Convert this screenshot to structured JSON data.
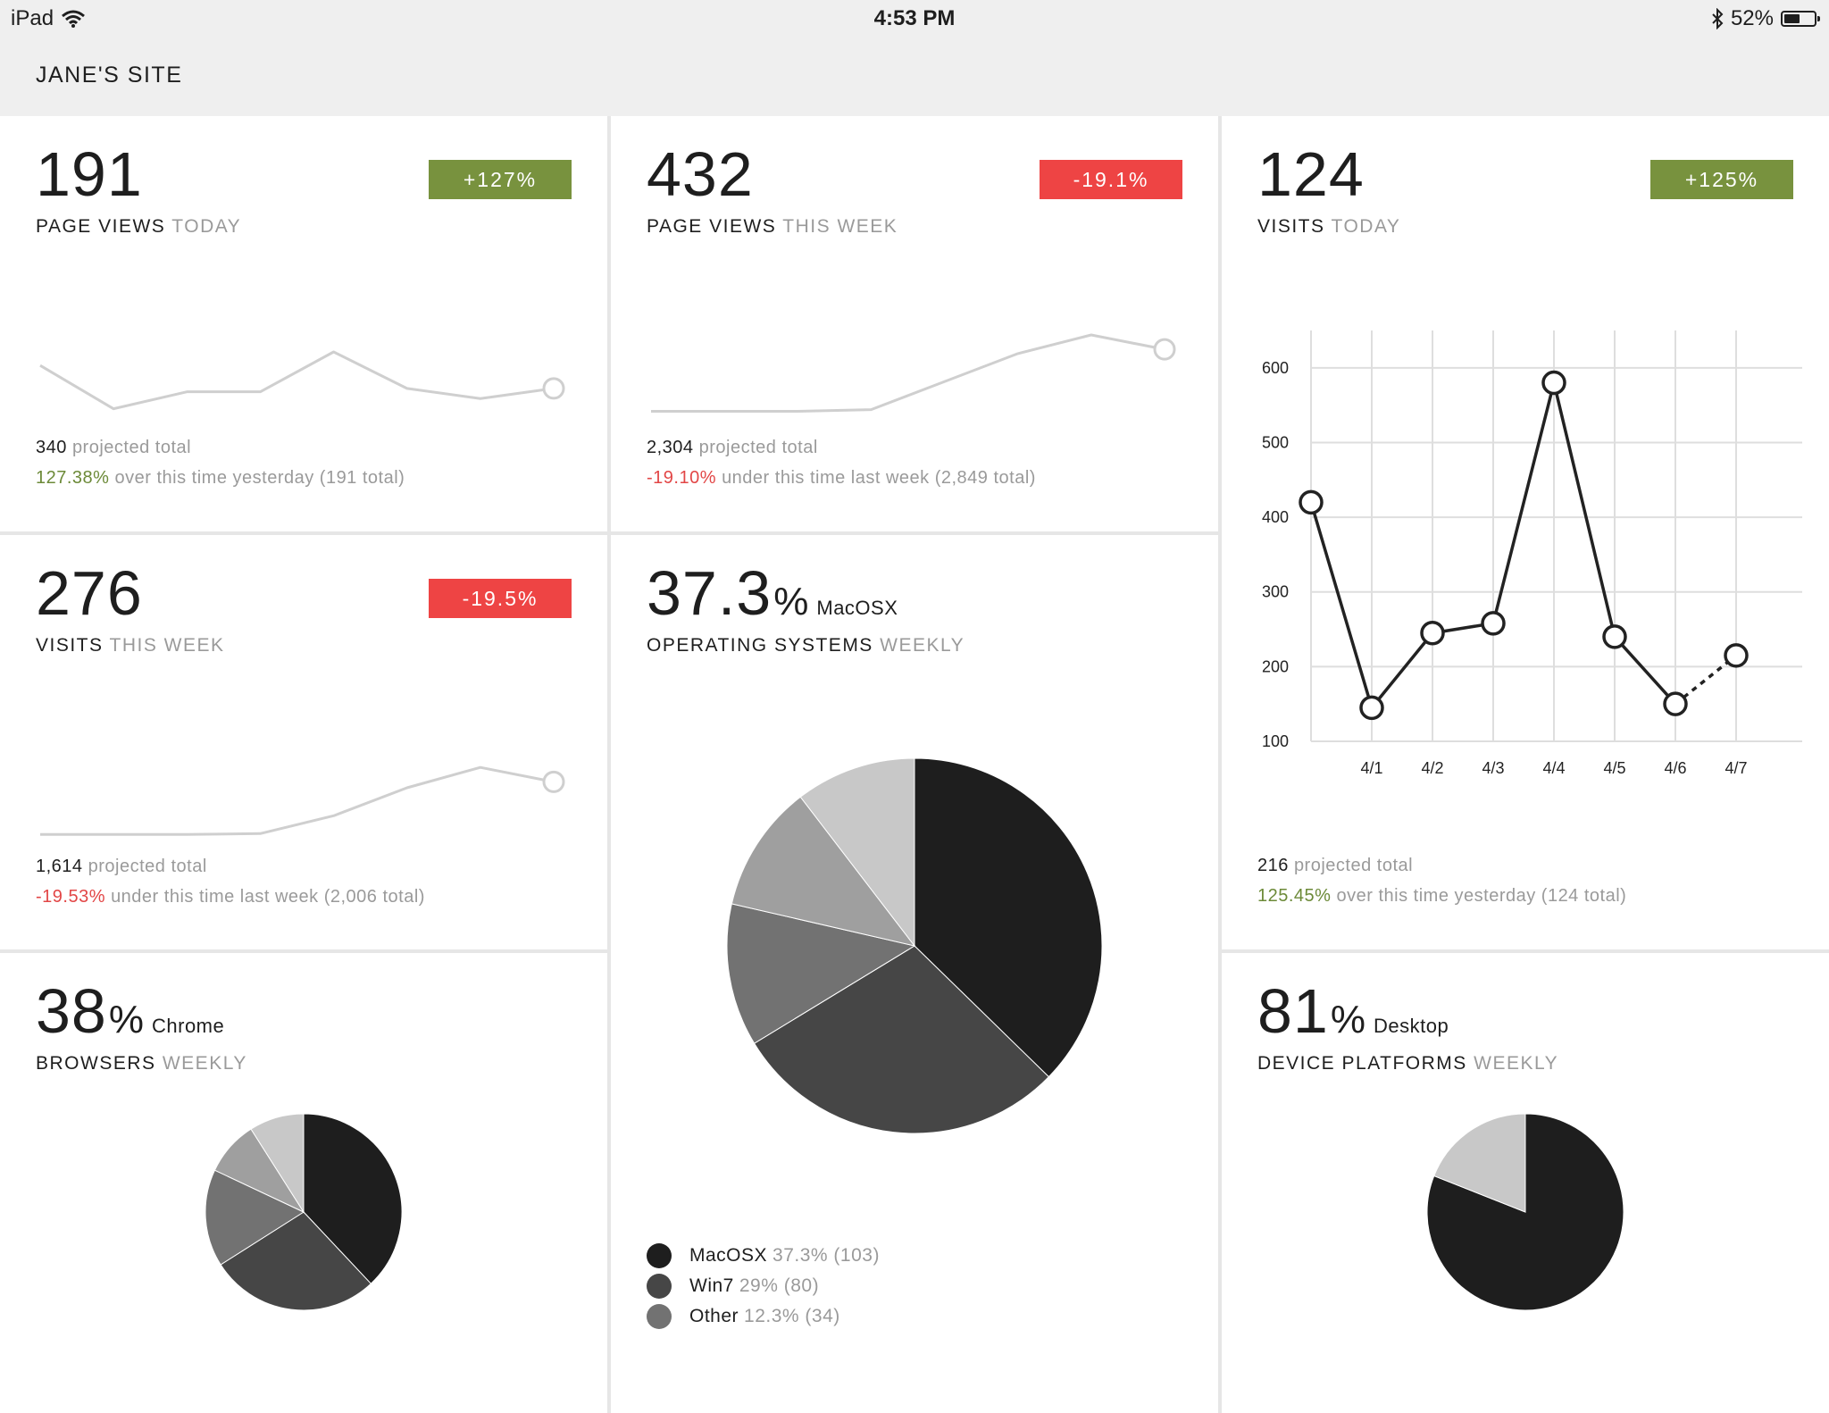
{
  "status_bar": {
    "device": "iPad",
    "time": "4:53 PM",
    "battery": "52%",
    "battery_level": 0.52
  },
  "site": {
    "title": "JANE'S SITE"
  },
  "cards": {
    "page_views_today": {
      "value": "191",
      "label": "PAGE VIEWS",
      "period": "TODAY",
      "badge": "+127%",
      "projected_value": "340",
      "projected_text": "projected total",
      "compare_value": "127.38%",
      "compare_text": "over this time yesterday (191 total)",
      "sparkline": [
        64,
        13,
        33,
        33,
        80,
        37,
        25,
        37
      ]
    },
    "page_views_week": {
      "value": "432",
      "label": "PAGE VIEWS",
      "period": "THIS WEEK",
      "badge": "-19.1%",
      "projected_value": "2,304",
      "projected_text": "projected total",
      "compare_value": "-19.10%",
      "compare_text": "under this time last week (2,849 total)",
      "sparkline": [
        10,
        10,
        10,
        12,
        45,
        78,
        100,
        83
      ]
    },
    "visits_today": {
      "value": "124",
      "label": "VISITS",
      "period": "TODAY",
      "badge": "+125%",
      "projected_value": "216",
      "projected_text": "projected total",
      "compare_value": "125.45%",
      "compare_text": "over this time yesterday (124 total)"
    },
    "visits_week": {
      "value": "276",
      "label": "VISITS",
      "period": "THIS WEEK",
      "badge": "-19.5%",
      "projected_value": "1,614",
      "projected_text": "projected total",
      "compare_value": "-19.53%",
      "compare_text": "under this time last week (2,006 total)",
      "sparkline": [
        5,
        5,
        5,
        6,
        27,
        60,
        84,
        67
      ]
    },
    "operating_systems": {
      "value": "37.3",
      "unit": "%",
      "leader": "MacOSX",
      "label": "OPERATING SYSTEMS",
      "period": "WEEKLY",
      "legend": [
        {
          "name": "MacOSX",
          "detail": "37.3% (103)",
          "color": "#1e1e1e"
        },
        {
          "name": "Win7",
          "detail": "29% (80)",
          "color": "#464646"
        },
        {
          "name": "Other",
          "detail": "12.3% (34)",
          "color": "#727272"
        }
      ]
    },
    "browsers": {
      "value": "38",
      "unit": "%",
      "leader": "Chrome",
      "label": "BROWSERS",
      "period": "WEEKLY"
    },
    "device_platforms": {
      "value": "81",
      "unit": "%",
      "leader": "Desktop",
      "label": "DEVICE PLATFORMS",
      "period": "WEEKLY"
    }
  },
  "colors": {
    "positive": "#78923e",
    "negative": "#ee4444",
    "sparkline": "#cfcfcf"
  },
  "chart_data": [
    {
      "type": "line",
      "x": [
        "",
        "4/1",
        "4/2",
        "4/3",
        "4/4",
        "4/5",
        "4/6",
        "4/7"
      ],
      "y_values": [
        420,
        145,
        245,
        258,
        580,
        240,
        150,
        215
      ],
      "ylim": [
        100,
        650
      ],
      "yticks": [
        100,
        200,
        300,
        400,
        500,
        600
      ],
      "grid": true,
      "last_segment_dashed": true,
      "xlabel": "",
      "ylabel": "",
      "title": ""
    },
    {
      "type": "pie",
      "slices": [
        {
          "value": 37.3,
          "color": "#1e1e1e"
        },
        {
          "value": 29.0,
          "color": "#464646"
        },
        {
          "value": 12.3,
          "color": "#727272"
        },
        {
          "value": 11.0,
          "color": "#9f9f9f"
        },
        {
          "value": 10.4,
          "color": "#c8c8c8"
        }
      ]
    },
    {
      "type": "pie",
      "slices": [
        {
          "value": 38,
          "color": "#1e1e1e"
        },
        {
          "value": 28,
          "color": "#464646"
        },
        {
          "value": 16,
          "color": "#727272"
        },
        {
          "value": 9,
          "color": "#9f9f9f"
        },
        {
          "value": 9,
          "color": "#c8c8c8"
        }
      ]
    },
    {
      "type": "pie",
      "slices": [
        {
          "value": 81,
          "color": "#1e1e1e"
        },
        {
          "value": 19,
          "color": "#c8c8c8"
        }
      ]
    }
  ]
}
